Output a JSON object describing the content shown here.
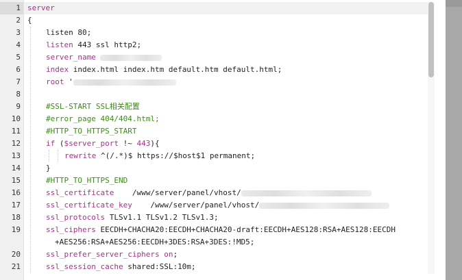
{
  "editor": {
    "lines": [
      {
        "n": "1",
        "parts": [
          {
            "t": "server",
            "c": "kw"
          }
        ]
      },
      {
        "n": "2",
        "parts": [
          {
            "t": "{",
            "c": ""
          }
        ]
      },
      {
        "n": "3",
        "parts": [
          {
            "t": "listen 80;",
            "c": ""
          }
        ]
      },
      {
        "n": "4",
        "parts": [
          {
            "t": "listen",
            "c": "kw"
          },
          {
            "t": " 443 ssl http2;",
            "c": ""
          }
        ]
      },
      {
        "n": "5",
        "parts": [
          {
            "t": "server_name",
            "c": "kw"
          },
          {
            "t": " ",
            "c": ""
          }
        ]
      },
      {
        "n": "6",
        "parts": [
          {
            "t": "index",
            "c": "kw"
          },
          {
            "t": " index.html index.htm default.htm default.html;",
            "c": ""
          }
        ]
      },
      {
        "n": "7",
        "parts": [
          {
            "t": "root",
            "c": "kw"
          },
          {
            "t": " '",
            "c": ""
          }
        ]
      },
      {
        "n": "8",
        "parts": []
      },
      {
        "n": "9",
        "parts": [
          {
            "t": "#SSL-START SSL相关配置",
            "c": "cm"
          }
        ]
      },
      {
        "n": "10",
        "parts": [
          {
            "t": "#error_page 404/404.html;",
            "c": "cm"
          }
        ]
      },
      {
        "n": "11",
        "parts": [
          {
            "t": "#HTTP_TO_HTTPS_START",
            "c": "cm"
          }
        ]
      },
      {
        "n": "12",
        "parts": [
          {
            "t": "if",
            "c": "kw"
          },
          {
            "t": " (",
            "c": ""
          },
          {
            "t": "$server_port",
            "c": "var"
          },
          {
            "t": " !~ ",
            "c": ""
          },
          {
            "t": "443",
            "c": "cn"
          },
          {
            "t": "){",
            "c": ""
          }
        ]
      },
      {
        "n": "13",
        "parts": [
          {
            "t": "rewrite",
            "c": "kw"
          },
          {
            "t": " ^(/.*)$ https://$host$1 permanent;",
            "c": ""
          }
        ]
      },
      {
        "n": "14",
        "parts": [
          {
            "t": "}",
            "c": ""
          }
        ]
      },
      {
        "n": "15",
        "parts": [
          {
            "t": "#HTTP_TO_HTTPS_END",
            "c": "cm"
          }
        ]
      },
      {
        "n": "16",
        "parts": [
          {
            "t": "ssl_certificate",
            "c": "kw"
          },
          {
            "t": "    /www/server/panel/vhost/",
            "c": ""
          }
        ]
      },
      {
        "n": "17",
        "parts": [
          {
            "t": "ssl_certificate_key",
            "c": "kw"
          },
          {
            "t": "    /www/server/panel/vhost/",
            "c": ""
          }
        ]
      },
      {
        "n": "18",
        "parts": [
          {
            "t": "ssl_protocols",
            "c": "kw"
          },
          {
            "t": " TLSv1.1 TLSv1.2 TLSv1.3;",
            "c": ""
          }
        ]
      },
      {
        "n": "19",
        "parts": [
          {
            "t": "ssl_ciphers",
            "c": "kw"
          },
          {
            "t": " EECDH+CHACHA20:EECDH+CHACHA20-draft:EECDH+AES128:RSA+AES128:EECDH",
            "c": ""
          }
        ]
      },
      {
        "n": "",
        "parts": [
          {
            "t": "+AES256:RSA+AES256:EECDH+3DES:RSA+3DES:!MD5;",
            "c": ""
          }
        ]
      },
      {
        "n": "20",
        "parts": [
          {
            "t": "ssl_prefer_server_ciphers",
            "c": "kw"
          },
          {
            "t": " ",
            "c": ""
          },
          {
            "t": "on",
            "c": "kw"
          },
          {
            "t": ";",
            "c": ""
          }
        ]
      },
      {
        "n": "21",
        "parts": [
          {
            "t": "ssl_session_cache",
            "c": "kw"
          },
          {
            "t": " shared:SSL:10m;",
            "c": ""
          }
        ]
      }
    ]
  }
}
